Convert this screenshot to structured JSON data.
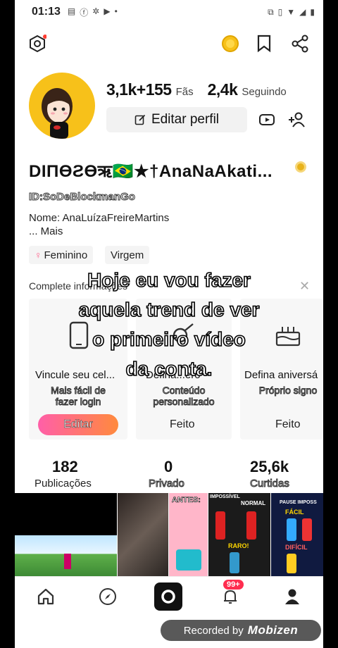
{
  "status_bar": {
    "time": "01:13"
  },
  "profile": {
    "stats": {
      "fans_count": "3,1k+155",
      "fans_label": "Fãs",
      "following_count": "2,4k",
      "following_label": "Seguindo"
    },
    "edit_button_label": "Editar perfil",
    "username": "DIΠϴƧϴऋ🇧🇷★†AnaNaAkati...",
    "user_id": "ID:SoDeBlockmanGo",
    "bio_line1": "Nome: AnaLuízaFreireMartins",
    "bio_line2": "...  Mais",
    "tags": [
      "Feminino",
      "Virgem"
    ]
  },
  "complete_profile": {
    "title": "Complete informações",
    "cards": [
      {
        "title": "Vincule seu cel...",
        "subtitle": "Mais fácil de\nfazer  login",
        "action": "Editar"
      },
      {
        "title": "Defina...ero",
        "subtitle": "Conteúdo\npersonalizado",
        "action": "Feito"
      },
      {
        "title": "Defina aniversá",
        "subtitle": "Próprio signo",
        "action": "Feito"
      }
    ]
  },
  "counts": [
    {
      "value": "182",
      "label": "Publicações"
    },
    {
      "value": "0",
      "label": "Privado"
    },
    {
      "value": "25,6k",
      "label": "Curtidas"
    }
  ],
  "thumbnails": {
    "thumb3_title": "ANTES:",
    "thumb4_row1a": "IMPOSSÍVEL",
    "thumb4_row1b": "NORMAL",
    "thumb4_row2": "RARO!",
    "thumb5_row1": "PAUSE IMPOSS",
    "thumb5_row2": "FÁCIL",
    "thumb5_row3": "DIFÍCIL"
  },
  "tab_bar": {
    "badge": "99+"
  },
  "caption_lines": [
    "Hoje eu vou fazer",
    "aquela trend de ver",
    "o primeiro vídeo",
    "da conta."
  ],
  "watermark": {
    "prefix": "Recorded by",
    "brand": "Mobizen"
  }
}
